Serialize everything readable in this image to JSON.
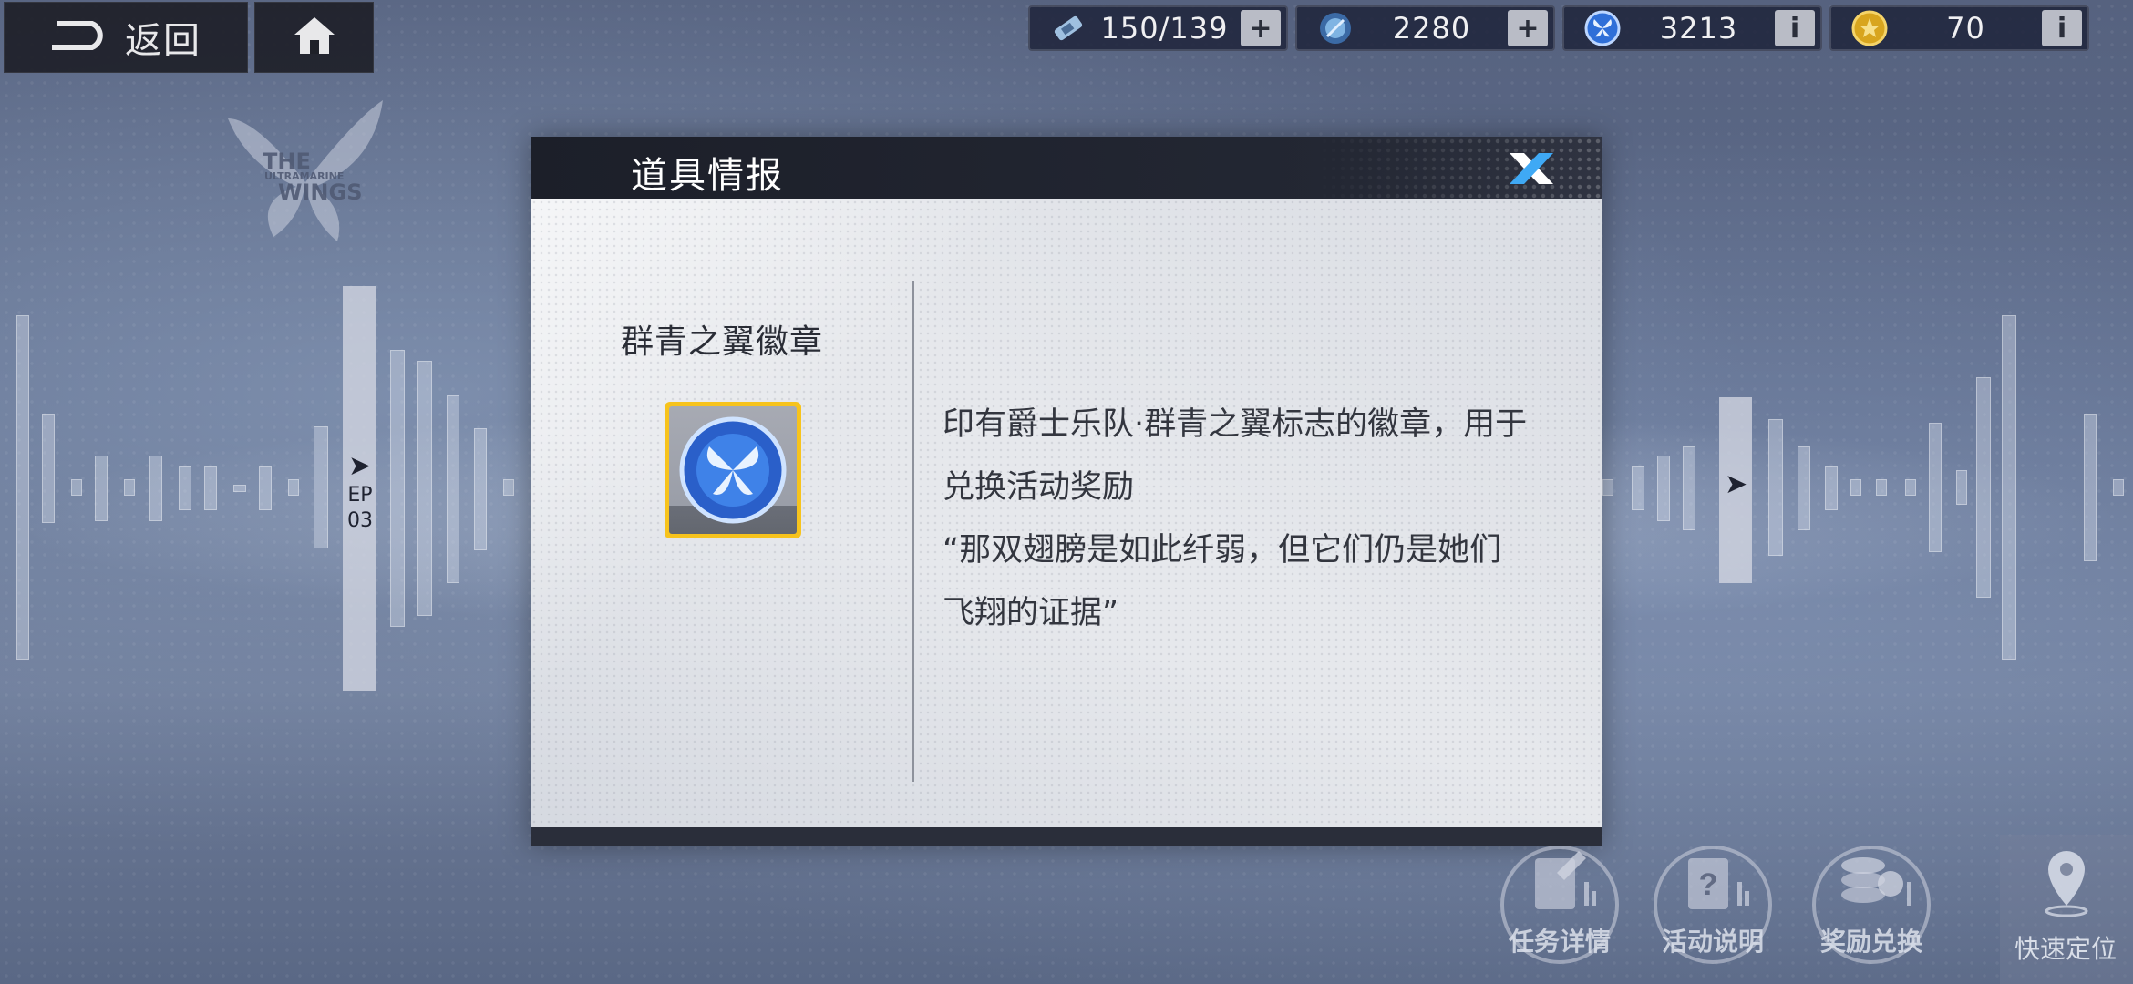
{
  "nav": {
    "back_label": "返回"
  },
  "resources": [
    {
      "name": "stamina",
      "value": "150/139",
      "action": "+"
    },
    {
      "name": "crystal",
      "value": "2280",
      "action": "+"
    },
    {
      "name": "ultramarine-badge",
      "value": "3213",
      "action": "i"
    },
    {
      "name": "gold-coin",
      "value": "70",
      "action": "i"
    }
  ],
  "logo": {
    "line1": "THE",
    "line2": "ULTRAMARINE",
    "line3": "WINGS"
  },
  "episode": {
    "label": "EP",
    "number": "03"
  },
  "modal": {
    "title": "道具情报",
    "item_name": "群青之翼徽章",
    "description_lines": [
      "印有爵士乐队·群青之翼标志的徽章，用于",
      "兑换活动奖励",
      "“那双翅膀是如此纤弱，但它们仍是她们",
      "飞翔的证据”"
    ]
  },
  "bottom_buttons": [
    {
      "label": "任务详情"
    },
    {
      "label": "活动说明"
    },
    {
      "label": "奖励兑换"
    }
  ],
  "locate_label": "快速定位",
  "colors": {
    "modal_header": "#1c1f29",
    "item_frame": "#f7c31c",
    "badge_blue": "#2f6fd8"
  }
}
